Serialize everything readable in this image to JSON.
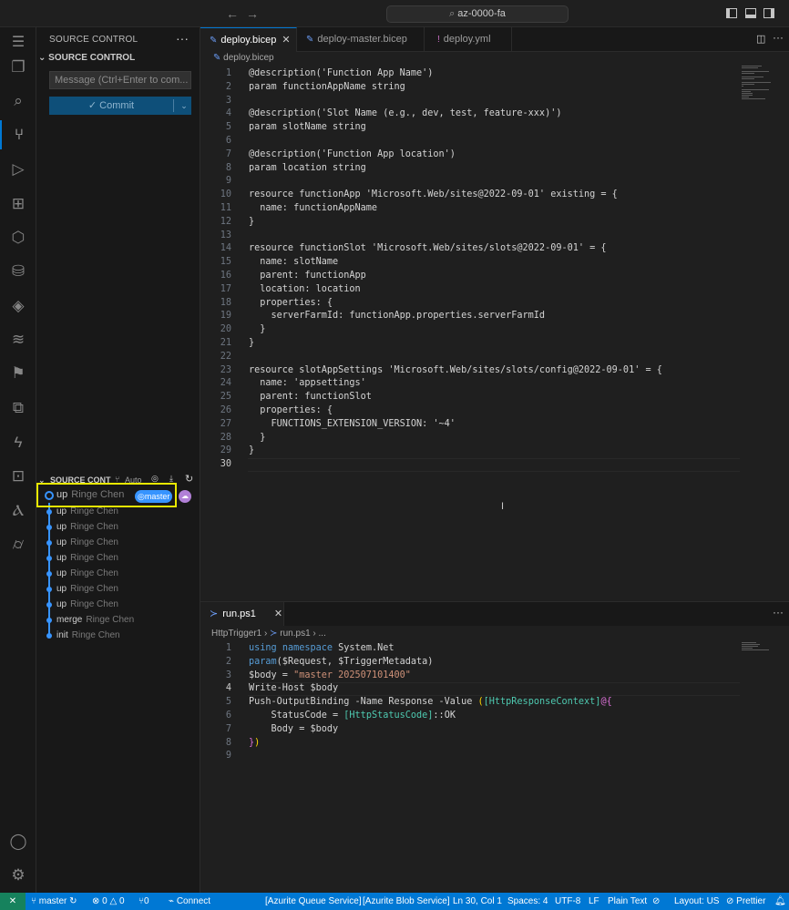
{
  "titlebar": {
    "search_text": "az-0000-fa",
    "back_icon": "arrow-left-icon",
    "forward_icon": "arrow-right-icon"
  },
  "activity_bar": {
    "items": [
      {
        "name": "explorer",
        "icon": "files-icon"
      },
      {
        "name": "search",
        "icon": "search-icon"
      },
      {
        "name": "source-control",
        "icon": "source-control-icon",
        "active": true
      },
      {
        "name": "run-debug",
        "icon": "run-debug-icon"
      },
      {
        "name": "extensions",
        "icon": "extensions-icon"
      },
      {
        "name": "docker",
        "icon": "box-icon"
      },
      {
        "name": "database",
        "icon": "database-icon"
      },
      {
        "name": "layers",
        "icon": "layers-icon"
      },
      {
        "name": "stack",
        "icon": "stack-icon"
      },
      {
        "name": "flow",
        "icon": "flow-icon"
      },
      {
        "name": "remote",
        "icon": "remote-icon"
      },
      {
        "name": "azure-functions",
        "icon": "function-icon"
      },
      {
        "name": "azure-functions-2",
        "icon": "function-box-icon"
      },
      {
        "name": "azure",
        "icon": "azure-icon"
      },
      {
        "name": "storage",
        "icon": "cylinder-icon"
      }
    ],
    "bottom": [
      {
        "name": "accounts",
        "icon": "account-icon"
      },
      {
        "name": "manage",
        "icon": "gear-icon"
      }
    ]
  },
  "sidebar": {
    "title": "SOURCE CONTROL",
    "section": "SOURCE CONTROL",
    "message_placeholder": "Message (Ctrl+Enter to com...",
    "commit_label": "✓ Commit",
    "graph_header": "SOURCE CONT",
    "graph_auto": "Auto",
    "branch_badge": "master",
    "graph": [
      {
        "message": "up",
        "author": "Ringe Chen"
      },
      {
        "message": "up",
        "author": "Ringe Chen"
      },
      {
        "message": "up",
        "author": "Ringe Chen"
      },
      {
        "message": "up",
        "author": "Ringe Chen"
      },
      {
        "message": "up",
        "author": "Ringe Chen"
      },
      {
        "message": "up",
        "author": "Ringe Chen"
      },
      {
        "message": "up",
        "author": "Ringe Chen"
      },
      {
        "message": "up",
        "author": "Ringe Chen"
      },
      {
        "message": "merge",
        "author": "Ringe Chen"
      },
      {
        "message": "init",
        "author": "Ringe Chen"
      }
    ]
  },
  "editor": {
    "tabs": [
      {
        "label": "deploy.bicep",
        "active": true
      },
      {
        "label": "deploy-master.bicep",
        "active": false
      },
      {
        "label": "deploy.yml",
        "active": false
      }
    ],
    "breadcrumb": "deploy.bicep",
    "current_line": 30,
    "lines": [
      "@description('Function App Name')",
      "param functionAppName string",
      "",
      "@description('Slot Name (e.g., dev, test, feature-xxx)')",
      "param slotName string",
      "",
      "@description('Function App location')",
      "param location string",
      "",
      "resource functionApp 'Microsoft.Web/sites@2022-09-01' existing = {",
      "  name: functionAppName",
      "}",
      "",
      "resource functionSlot 'Microsoft.Web/sites/slots@2022-09-01' = {",
      "  name: slotName",
      "  parent: functionApp",
      "  location: location",
      "  properties: {",
      "    serverFarmId: functionApp.properties.serverFarmId",
      "  }",
      "}",
      "",
      "resource slotAppSettings 'Microsoft.Web/sites/slots/config@2022-09-01' = {",
      "  name: 'appsettings'",
      "  parent: functionSlot",
      "  properties: {",
      "    FUNCTIONS_EXTENSION_VERSION: '~4'",
      "  }",
      "}",
      ""
    ]
  },
  "panel": {
    "tab": "run.ps1",
    "breadcrumb_folder": "HttpTrigger1",
    "breadcrumb_file": "run.ps1",
    "breadcrumb_more": "...",
    "current_line": 4,
    "line_numbers": [
      "1",
      "2",
      "3",
      "4",
      "5",
      "6",
      "7",
      "8",
      "9"
    ],
    "lines": {
      "l1_kw1": "using",
      "l1_kw2": "namespace",
      "l1_rest": " System.Net",
      "l2_kw": "param",
      "l2_rest": "($Request, $TriggerMetadata)",
      "l3_var": "$body",
      "l3_eq": " = ",
      "l3_str": "\"master 202507101400\"",
      "l4": "Write-Host $body",
      "l5_pre": "Push-OutputBinding -Name Response -Value ",
      "l5_b1": "(",
      "l5_type": "[HttpResponseContext]",
      "l5_at": "@{",
      "l6_pre": "    StatusCode = ",
      "l6_type": "[HttpStatusCode]",
      "l6_post": "::OK",
      "l7": "    Body = $body",
      "l8_close1": "}",
      "l8_close2": ")"
    }
  },
  "statusbar": {
    "branch": "master",
    "errors": "0",
    "warnings": "0",
    "ports": "0",
    "connect": "Connect",
    "queue": "[Azurite Queue Service]",
    "blob": "[Azurite Blob Service]",
    "position": "Ln 30, Col 1",
    "spaces": "Spaces: 4",
    "encoding": "UTF-8",
    "eol": "LF",
    "language": "Plain Text",
    "layout": "Layout: US",
    "formatter": "Prettier"
  }
}
